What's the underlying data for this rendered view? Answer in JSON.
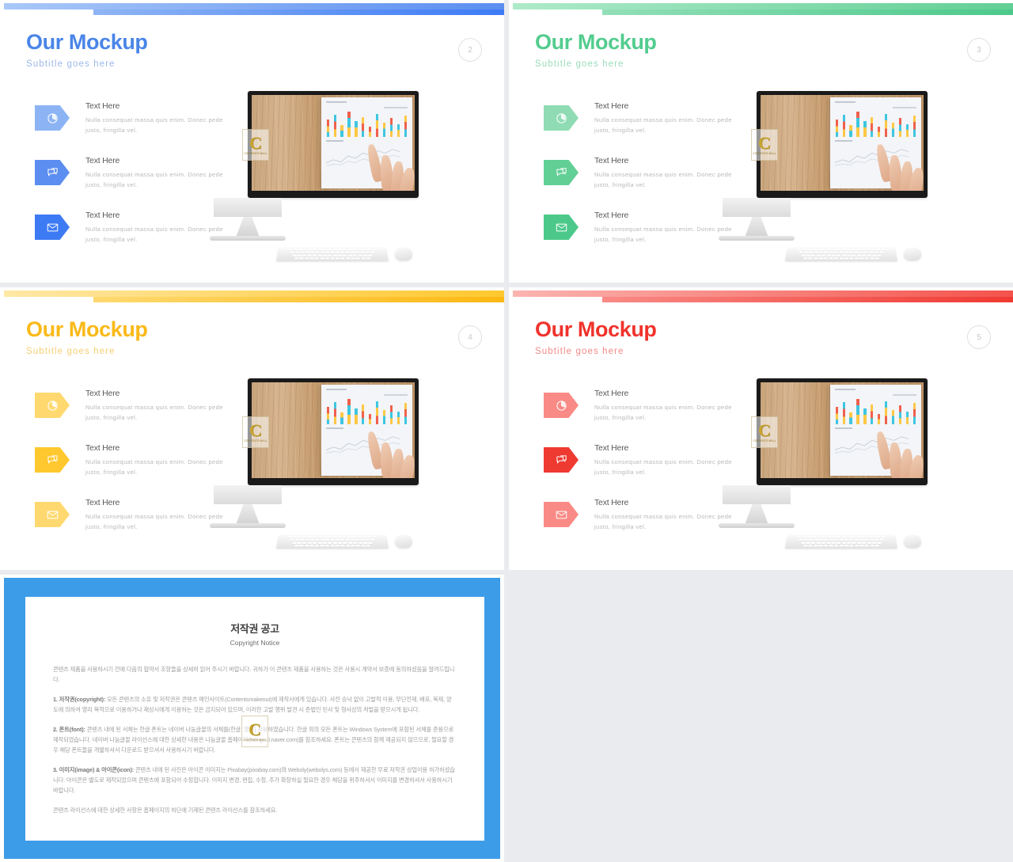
{
  "theme": {
    "blue": {
      "light": "#8cb4f5",
      "mid": "#5b8ef0",
      "strong": "#3d7bf5",
      "title": "#4a85e8",
      "sub": "#9cb8e8"
    },
    "green": {
      "light": "#8fdcb4",
      "mid": "#62cf95",
      "strong": "#4cc98a",
      "title": "#53cc8e",
      "sub": "#9adcbc"
    },
    "yellow": {
      "light": "#ffd970",
      "mid": "#ffc82e",
      "strong": "#fcb813",
      "title": "#f9b917",
      "sub": "#f7cf74"
    },
    "red": {
      "light": "#f98a85",
      "mid": "#f4534c",
      "strong": "#ef3a32",
      "title": "#f0332c",
      "sub": "#f08a86"
    },
    "copyright_border": "#3c9ce8",
    "watermark_gold": "#c8a52e",
    "page_text": "#c8c8c8"
  },
  "slides": [
    {
      "id": "slide-2",
      "accent": "blue",
      "title": "Our Mockup",
      "subtitle": "Subtitle  goes  here",
      "page": "2",
      "features": [
        {
          "icon": "pie-chart-icon",
          "title": "Text Here",
          "desc": "Nulla consequat massa quis enim. Donec pede justo, fringilla  vel."
        },
        {
          "icon": "speech-bubble-icon",
          "title": "Text Here",
          "desc": "Nulla consequat massa quis enim. Donec pede justo, fringilla  vel."
        },
        {
          "icon": "envelope-icon",
          "title": "Text Here",
          "desc": "Nulla consequat massa quis enim. Donec pede justo, fringilla  vel."
        }
      ]
    },
    {
      "id": "slide-3",
      "accent": "green",
      "title": "Our Mockup",
      "subtitle": "Subtitle  goes  here",
      "page": "3",
      "features": [
        {
          "icon": "pie-chart-icon",
          "title": "Text Here",
          "desc": "Nulla consequat massa quis enim. Donec pede justo, fringilla  vel."
        },
        {
          "icon": "speech-bubble-icon",
          "title": "Text Here",
          "desc": "Nulla consequat massa quis enim. Donec pede justo, fringilla  vel."
        },
        {
          "icon": "envelope-icon",
          "title": "Text Here",
          "desc": "Nulla consequat massa quis enim. Donec pede justo, fringilla  vel."
        }
      ]
    },
    {
      "id": "slide-4",
      "accent": "yellow",
      "title": "Our Mockup",
      "subtitle": "Subtitle  goes  here",
      "page": "4",
      "features": [
        {
          "icon": "pie-chart-icon",
          "title": "Text Here",
          "desc": "Nulla consequat massa quis enim. Donec pede justo, fringilla  vel."
        },
        {
          "icon": "speech-bubble-icon",
          "title": "Text Here",
          "desc": "Nulla consequat massa quis enim. Donec pede justo, fringilla  vel."
        },
        {
          "icon": "envelope-icon",
          "title": "Text Here",
          "desc": "Nulla consequat massa quis enim. Donec pede justo, fringilla  vel."
        }
      ]
    },
    {
      "id": "slide-5",
      "accent": "red",
      "title": "Our Mockup",
      "subtitle": "Subtitle  goes  here",
      "page": "5",
      "features": [
        {
          "icon": "pie-chart-icon",
          "title": "Text Here",
          "desc": "Nulla consequat massa quis enim. Donec pede justo, fringilla  vel."
        },
        {
          "icon": "speech-bubble-icon",
          "title": "Text Here",
          "desc": "Nulla consequat massa quis enim. Donec pede justo, fringilla  vel."
        },
        {
          "icon": "envelope-icon",
          "title": "Text Here",
          "desc": "Nulla consequat massa quis enim. Donec pede justo, fringilla  vel."
        }
      ]
    }
  ],
  "watermark": {
    "letter": "C",
    "caption": "CONTENTS MALL"
  },
  "copyright": {
    "title": "저작권 공고",
    "subtitle": "Copyright Notice",
    "intro": "콘텐츠 제품을 사용하시기 전에 다음의 협약서 조항들을 상세히 읽어 주시기 바랍니다. 귀하가 이 콘텐츠 제품을 사용하는 것은 사용시 계약서 보증에 동의하셨음을 알려드립니다.",
    "sections": [
      {
        "heading": "1. 저작권(copyright):",
        "text": "모든 콘텐츠의 소유 및 저작권은 콘텐츠 메인사이트(Contentsmakeout)에 제작사에게 있습니다. 사전 승낙 없이 고발적 이용, 무단전재, 배포, 복제, 양도에 의하여 영리 목적으로 이용하거나 재상시에게 이용하는 것은 금지되어 있으며, 이러한 고발 행위 발견 시 준법인 민사 및 형사상의 처벌을 받으시게 됩니다."
      },
      {
        "heading": "2. 폰트(font):",
        "text": "콘텐츠 내에 된 서체는 한글 폰트는 네이버 나눔글꼴의 서체를(한글, 영문) 사용하였습니다. 한글 외의 모든 폰트는 Windows System에 포함된 서체를 준용으로 제작되었습니다. 네이버 나눔글꼴 라이선스에 대한 상세한 내용은 나눔글꼴 홈페이지(hangeul.naver.com)를 참조하세요. 폰트는 콘텐츠의 함께 제공되지 않으므로, 필요할 경우 해당 폰트들을 개별하셔서 다운로드 받으셔서 사용하시기 바랍니다."
      },
      {
        "heading": "3. 이미지(image) & 아이콘(icon):",
        "text": "콘텐츠 내에 된 사진은 아이콘 이미지는 Pixabay(pixabay.com)와 Weboly(webolys.com) 등에서 제공한 무료 저작권 상업이용 허가하셨습니다. 아이콘은 별도로 제작되었으며 콘텐츠에 포함되어 수정합니다. 이미지 변경, 편집, 수정, 추가 확장하실 필요한 경우 해당을 위주하셔서 이미지를 변경하셔서 사용하시기 바랍니다."
      }
    ],
    "footer": "콘텐츠 라이선스에 대한 상세한 사항은 홈페이지의 하단에 기재된 콘텐츠 라이선스를 참조하세요."
  }
}
